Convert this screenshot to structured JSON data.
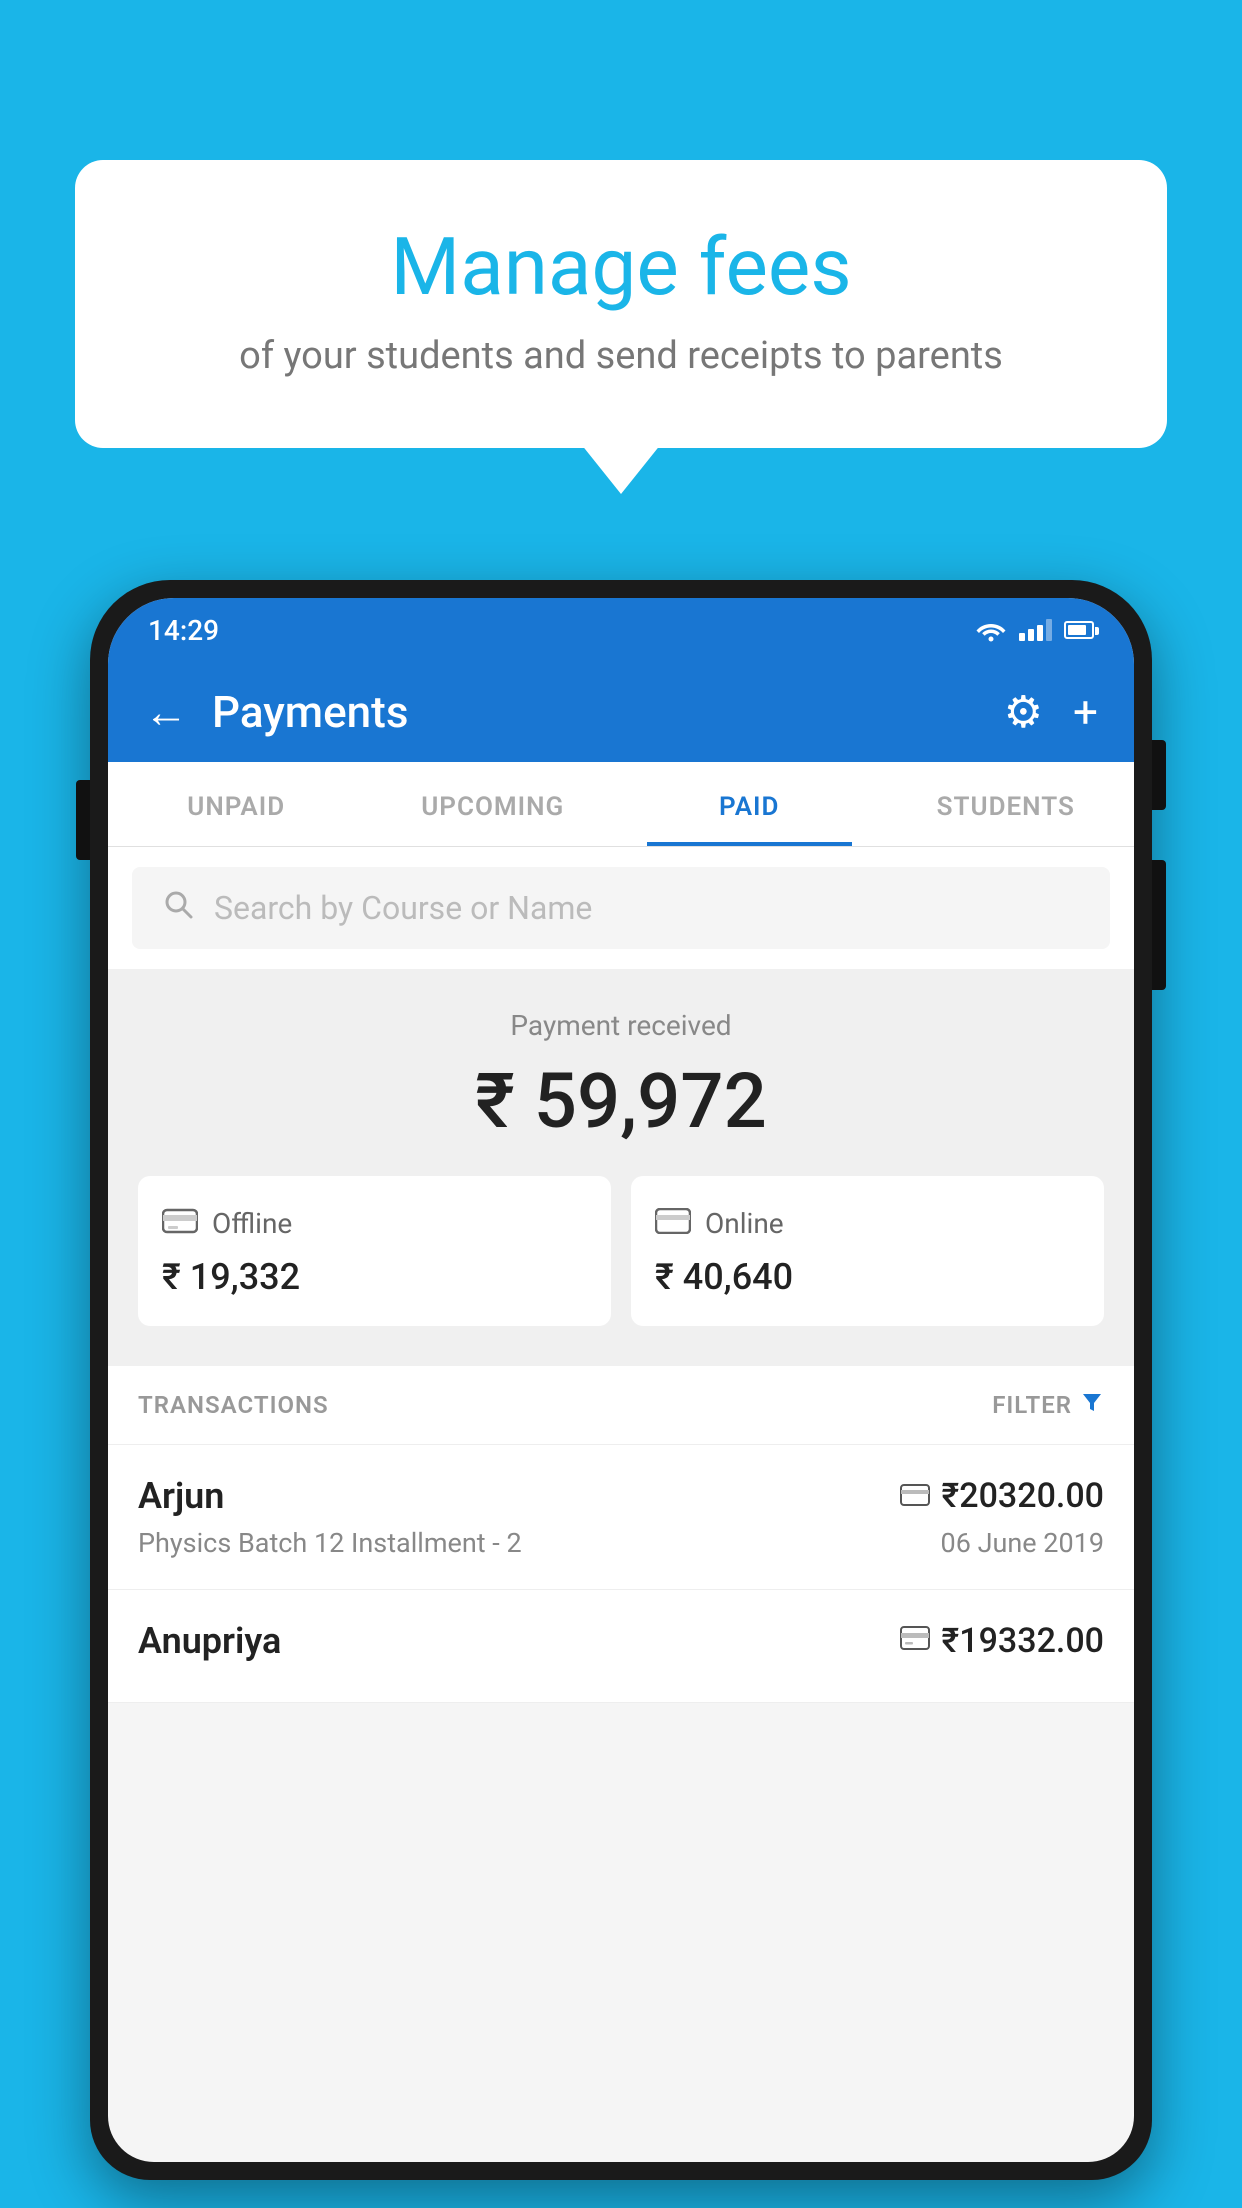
{
  "background_color": "#1ab5e8",
  "tooltip": {
    "title": "Manage fees",
    "subtitle": "of your students and send receipts to parents"
  },
  "phone": {
    "status_bar": {
      "time": "14:29"
    },
    "header": {
      "title": "Payments",
      "back_label": "←",
      "gear_label": "⚙",
      "plus_label": "+"
    },
    "tabs": [
      {
        "label": "UNPAID",
        "active": false
      },
      {
        "label": "UPCOMING",
        "active": false
      },
      {
        "label": "PAID",
        "active": true
      },
      {
        "label": "STUDENTS",
        "active": false
      }
    ],
    "search": {
      "placeholder": "Search by Course or Name"
    },
    "payment_summary": {
      "label": "Payment received",
      "total": "₹ 59,972",
      "offline": {
        "label": "Offline",
        "amount": "₹ 19,332"
      },
      "online": {
        "label": "Online",
        "amount": "₹ 40,640"
      }
    },
    "transactions_header": {
      "label": "TRANSACTIONS",
      "filter_label": "FILTER"
    },
    "transactions": [
      {
        "name": "Arjun",
        "amount": "₹20320.00",
        "course": "Physics Batch 12 Installment - 2",
        "date": "06 June 2019",
        "payment_type": "card"
      },
      {
        "name": "Anupriya",
        "amount": "₹19332.00",
        "course": "",
        "date": "",
        "payment_type": "offline"
      }
    ]
  }
}
